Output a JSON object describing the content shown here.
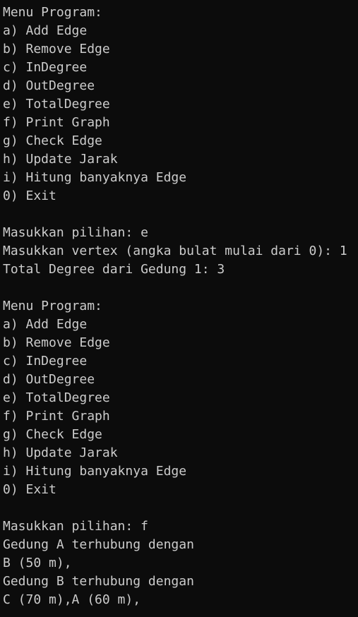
{
  "terminal": {
    "lines": [
      "Menu Program:",
      "a) Add Edge",
      "b) Remove Edge",
      "c) InDegree",
      "d) OutDegree",
      "e) TotalDegree",
      "f) Print Graph",
      "g) Check Edge",
      "h) Update Jarak",
      "i) Hitung banyaknya Edge",
      "0) Exit",
      "",
      "Masukkan pilihan: e",
      "Masukkan vertex (angka bulat mulai dari 0): 1",
      "Total Degree dari Gedung 1: 3",
      "",
      "Menu Program:",
      "a) Add Edge",
      "b) Remove Edge",
      "c) InDegree",
      "d) OutDegree",
      "e) TotalDegree",
      "f) Print Graph",
      "g) Check Edge",
      "h) Update Jarak",
      "i) Hitung banyaknya Edge",
      "0) Exit",
      "",
      "Masukkan pilihan: f",
      "Gedung A terhubung dengan",
      "B (50 m),",
      "Gedung B terhubung dengan",
      "C (70 m),A (60 m),"
    ]
  }
}
